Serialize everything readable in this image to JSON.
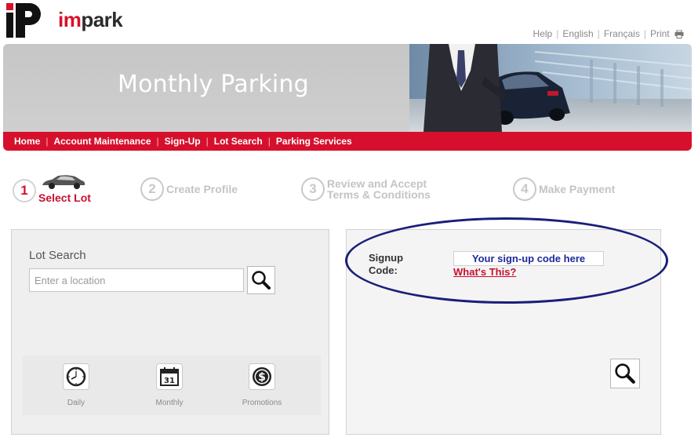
{
  "brand": {
    "im": "im",
    "park": "park"
  },
  "top_links": {
    "help": "Help",
    "english": "English",
    "francais": "Français",
    "print": "Print",
    "sep": "|"
  },
  "banner": {
    "title": "Monthly Parking"
  },
  "nav": {
    "items": [
      "Home",
      "Account Maintenance",
      "Sign-Up",
      "Lot Search",
      "Parking Services"
    ],
    "sep": "|"
  },
  "steps": [
    {
      "num": "1",
      "label": "Select Lot",
      "active": true
    },
    {
      "num": "2",
      "label": "Create Profile",
      "active": false
    },
    {
      "num": "3",
      "label_line1": "Review and Accept",
      "label_line2": "Terms & Conditions",
      "active": false
    },
    {
      "num": "4",
      "label": "Make Payment",
      "active": false
    }
  ],
  "lot_search": {
    "title": "Lot Search",
    "placeholder": "Enter a location",
    "tiles": [
      {
        "label": "Daily",
        "icon": "clock-icon"
      },
      {
        "label": "Monthly",
        "icon": "calendar-icon",
        "calendar_day": "31"
      },
      {
        "label": "Promotions",
        "icon": "dollar-icon"
      }
    ]
  },
  "signup": {
    "label_line1": "Signup",
    "label_line2": "Code:",
    "placeholder": "Your sign-up code here",
    "whats_this": "What's This?"
  },
  "colors": {
    "accent_red": "#d6102c",
    "annotation_blue": "#1a1f7a",
    "code_blue": "#1e2a9a"
  }
}
